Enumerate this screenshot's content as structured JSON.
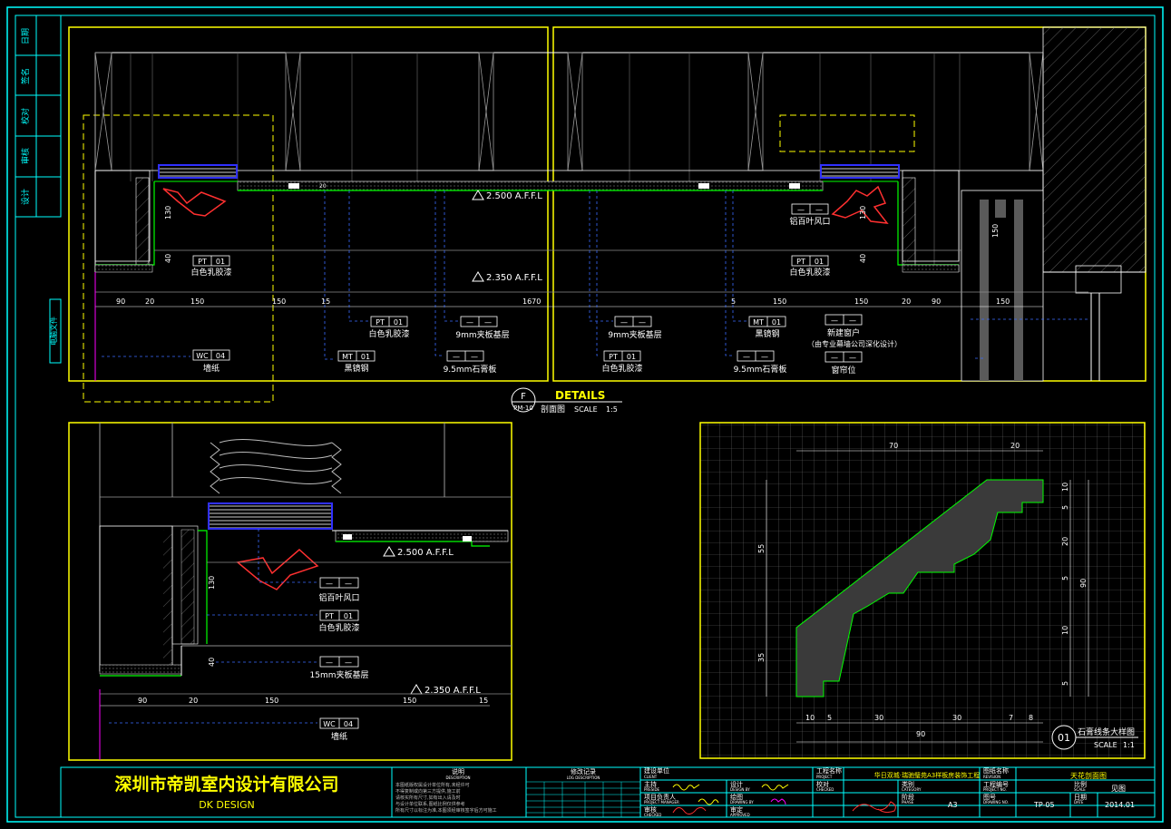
{
  "colors": {
    "background": "#000000",
    "frame": "#00ffff",
    "viewport": "#ffff00",
    "geometry": "#ffffff",
    "dimension": "#00ffff",
    "finish_line": "#00ff00",
    "hatch": "#666666",
    "arrow": "#ff3030",
    "vent": "#3030ff",
    "profile_fill": "#3a3a3a",
    "grid": "#7a7a7a"
  },
  "left_strip": {
    "labels": [
      "日期",
      "签名",
      "校对",
      "审核",
      "设计"
    ],
    "file_tag": "电脑文件"
  },
  "main_section": {
    "levels": {
      "level_upper": "2.500 A.F.F.L",
      "level_lower": "2.350 A.F.F.L"
    },
    "dims": {
      "d1": "90",
      "d2": "20",
      "d3": "150",
      "d4": "150",
      "d5": "15",
      "d6": "1670",
      "d7": "5",
      "d8": "150",
      "d9": "150",
      "d10": "20",
      "d11": "90",
      "d12": "150",
      "v1": "130",
      "v2": "40",
      "v3": "130",
      "v4": "40",
      "v5": "150",
      "s1": "20",
      "s2": "20",
      "s3": "20",
      "s4": "90"
    },
    "tags": {
      "pt_left": {
        "code": "PT",
        "num": "01",
        "text": "白色乳胶漆"
      },
      "pt_right": {
        "code": "PT",
        "num": "01",
        "text": "白色乳胶漆"
      },
      "pt_mid": {
        "code": "PT",
        "num": "01",
        "text": "白色乳胶漆"
      },
      "pt_mid2": {
        "code": "PT",
        "num": "01",
        "text": "白色乳胶漆"
      },
      "wc": {
        "code": "WC",
        "num": "04",
        "text": "墙纸"
      },
      "mt_left": {
        "code": "MT",
        "num": "01",
        "text": "黑镜钢"
      },
      "mt_right": {
        "code": "MT",
        "num": "01",
        "text": "黑镜钢"
      },
      "ply_left": {
        "code": "—",
        "num": "—",
        "text": "9mm夹板基层"
      },
      "ply_right": {
        "code": "—",
        "num": "—",
        "text": "9mm夹板基层"
      },
      "gyp_left": {
        "code": "—",
        "num": "—",
        "text": "9.5mm石膏板"
      },
      "gyp_right": {
        "code": "—",
        "num": "—",
        "text": "9.5mm石膏板"
      },
      "louver": {
        "code": "—",
        "num": "—",
        "text": "铝百叶风口"
      },
      "window": {
        "code": "—",
        "num": "—",
        "text": "新建窗户",
        "note": "（由专业幕墙公司深化设计）"
      },
      "curtain": {
        "code": "—",
        "num": "—",
        "text": "窗帘位"
      }
    }
  },
  "detail_title": {
    "letter": "F",
    "sheet": "PM-10",
    "title": "DETAILS",
    "subtitle": "剖面图",
    "scale_label": "SCALE",
    "scale": "1:5"
  },
  "bottom_left": {
    "level_upper": "2.500 A.F.F.L",
    "level_lower": "2.350 A.F.F.L",
    "dims": {
      "d1": "90",
      "d2": "20",
      "d3": "150",
      "d4": "150",
      "d5": "15",
      "v1": "130",
      "v2": "40",
      "s1": "20",
      "s2": "20"
    },
    "tags": {
      "louver": {
        "code": "—",
        "num": "—",
        "text": "铝百叶风口"
      },
      "pt": {
        "code": "PT",
        "num": "01",
        "text": "白色乳胶漆"
      },
      "ply": {
        "code": "—",
        "num": "—",
        "text": "15mm夹板基层"
      },
      "wc": {
        "code": "WC",
        "num": "04",
        "text": "墙纸"
      }
    }
  },
  "profile_detail": {
    "number": "01",
    "title": "石膏线条大样图",
    "scale_label": "SCALE",
    "scale": "1:1",
    "top_dims": [
      "70",
      "20"
    ],
    "bottom_dims": [
      "10",
      "5",
      "30",
      "30",
      "7",
      "8"
    ],
    "bottom_total": "90",
    "left_dims": [
      "55",
      "35"
    ],
    "right_dims": [
      "10",
      "5",
      "20",
      "5",
      "10",
      "5"
    ],
    "right_total": "90"
  },
  "title_block": {
    "company_cn": "深圳市帝凯室内设计有限公司",
    "company_en": "DK   DESIGN",
    "desc_title": "说明",
    "desc_title_en": "DESCRIPTION",
    "desc_lines": [
      "本图纸版权属设计单位所有,未经许可",
      "不得复制或向第三方提供,施工前",
      "请核实所有尺寸,如有出入请及时",
      "与设计单位联系,图纸比例仅供参考",
      "所有尺寸以标注为准,本图须经审核签字后方可施工"
    ],
    "rev_title": "修改记录",
    "rev_title_en": "LOG DESCRIPTION",
    "client_label": "建设单位",
    "client_en": "CLIENT",
    "principal": "主持",
    "principal_en": "PRESIDE",
    "design": "设计",
    "design_en": "DESIGN BY",
    "pm": "项目负责人",
    "pm_en": "PROJECT MANAGER",
    "drawing": "绘图",
    "drawing_en": "DRAWING BY",
    "checked": "审核",
    "checked_en": "CHECKED",
    "approved": "审定",
    "approved_en": "APPROVED",
    "project_label": "工程名称",
    "project_en": "PROJECT",
    "project_value": "华日双城·瑞驰璧苑A3样板房装饰工程",
    "checked2": "校对",
    "checked2_en": "CHECKED",
    "category_label": "类别",
    "category_en": "CATEGORY",
    "phase_label": "阶段",
    "phase_en": "PHASE",
    "phase_value": "A3",
    "drawing_name_label": "图纸名称",
    "drawing_name_en": "REVISION",
    "drawing_name_value": "天花剖面图",
    "project_no_label": "工程编号",
    "project_no_en": "PROJECT NO.",
    "scale_label": "比例",
    "scale_en": "SCALE",
    "scale_value": "见图",
    "drawing_no_label": "图号",
    "drawing_no_en": "DRAWING NO.",
    "drawing_no_value": "TP-05",
    "date_label": "日期",
    "date_en": "DATE",
    "date_value": "2014.01"
  }
}
